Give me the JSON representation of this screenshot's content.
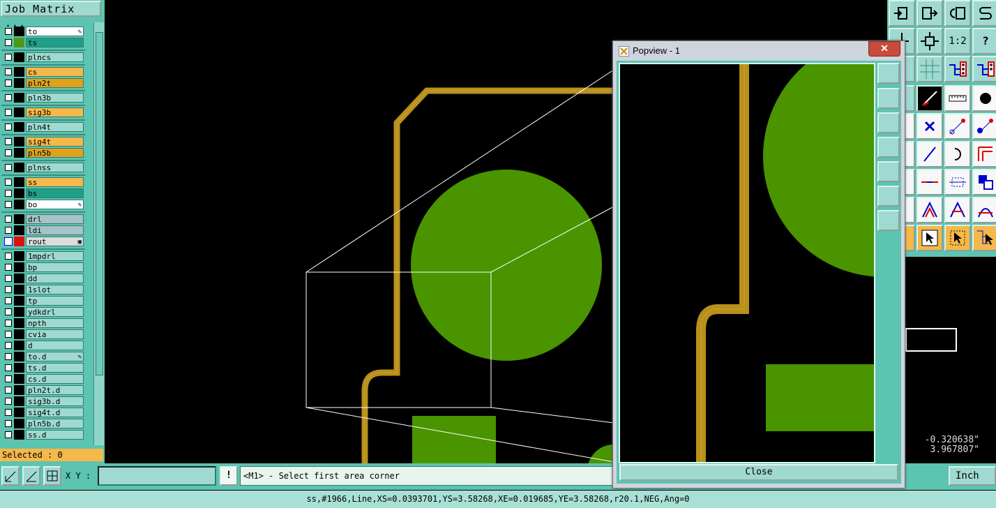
{
  "job_matrix": {
    "title": "Job Matrix ...",
    "selected_text": "Selected : 0",
    "layers": [
      {
        "name": "to",
        "color": "#ffffff",
        "swatch": "#000000",
        "mark": "✎"
      },
      {
        "name": "ts",
        "color": "#1f9f88",
        "swatch": "#4a9a1a",
        "mark": ""
      },
      {
        "name": "plncs",
        "color": "#9fd9cf",
        "swatch": "#000000",
        "mark": ""
      },
      {
        "name": "cs",
        "color": "#f5b84a",
        "swatch": "#000000",
        "mark": ""
      },
      {
        "name": "pln2t",
        "color": "#e0a21c",
        "swatch": "#000000",
        "mark": ""
      },
      {
        "name": "pln3b",
        "color": "#9fd9cf",
        "swatch": "#000000",
        "mark": ""
      },
      {
        "name": "sig3b",
        "color": "#f5b84a",
        "swatch": "#000000",
        "mark": ""
      },
      {
        "name": "pln4t",
        "color": "#9fd9cf",
        "swatch": "#000000",
        "mark": ""
      },
      {
        "name": "sig4t",
        "color": "#f5b84a",
        "swatch": "#000000",
        "mark": ""
      },
      {
        "name": "pln5b",
        "color": "#e0a21c",
        "swatch": "#000000",
        "mark": ""
      },
      {
        "name": "plnss",
        "color": "#9fd9cf",
        "swatch": "#000000",
        "mark": ""
      },
      {
        "name": "ss",
        "color": "#f5b84a",
        "swatch": "#000000",
        "mark": ""
      },
      {
        "name": "bs",
        "color": "#1f9f88",
        "swatch": "#000000",
        "mark": ""
      },
      {
        "name": "bo",
        "color": "#ffffff",
        "swatch": "#000000",
        "mark": "✎"
      },
      {
        "name": "drl",
        "color": "#a8c2c8",
        "swatch": "#000000",
        "mark": ""
      },
      {
        "name": "ldi",
        "color": "#a8c2c8",
        "swatch": "#000000",
        "mark": ""
      },
      {
        "name": "rout",
        "color": "#dcdcdc",
        "swatch": "#e01010",
        "mark": "▣"
      },
      {
        "name": "1mpdrl",
        "color": "#9fd9cf",
        "swatch": "#000000",
        "mark": ""
      },
      {
        "name": "bp",
        "color": "#9fd9cf",
        "swatch": "#000000",
        "mark": ""
      },
      {
        "name": "dd",
        "color": "#9fd9cf",
        "swatch": "#000000",
        "mark": ""
      },
      {
        "name": "1slot",
        "color": "#9fd9cf",
        "swatch": "#000000",
        "mark": ""
      },
      {
        "name": "tp",
        "color": "#9fd9cf",
        "swatch": "#000000",
        "mark": ""
      },
      {
        "name": "ydkdrl",
        "color": "#9fd9cf",
        "swatch": "#000000",
        "mark": ""
      },
      {
        "name": "npth",
        "color": "#9fd9cf",
        "swatch": "#000000",
        "mark": ""
      },
      {
        "name": "cvia",
        "color": "#9fd9cf",
        "swatch": "#000000",
        "mark": ""
      },
      {
        "name": "d",
        "color": "#9fd9cf",
        "swatch": "#000000",
        "mark": ""
      },
      {
        "name": "to.d",
        "color": "#9fd9cf",
        "swatch": "#000000",
        "mark": "✎"
      },
      {
        "name": "ts.d",
        "color": "#9fd9cf",
        "swatch": "#000000",
        "mark": ""
      },
      {
        "name": "cs.d",
        "color": "#9fd9cf",
        "swatch": "#000000",
        "mark": ""
      },
      {
        "name": "pln2t.d",
        "color": "#9fd9cf",
        "swatch": "#000000",
        "mark": ""
      },
      {
        "name": "sig3b.d",
        "color": "#9fd9cf",
        "swatch": "#000000",
        "mark": ""
      },
      {
        "name": "sig4t.d",
        "color": "#9fd9cf",
        "swatch": "#000000",
        "mark": ""
      },
      {
        "name": "pln5b.d",
        "color": "#9fd9cf",
        "swatch": "#000000",
        "mark": ""
      },
      {
        "name": "ss.d",
        "color": "#9fd9cf",
        "swatch": "#000000",
        "mark": ""
      }
    ]
  },
  "command_bar": {
    "xy_label": "X Y :",
    "xy_value": "",
    "info_icon": "!",
    "prompt": "<M1> - Select first area corner",
    "unit": "Inch"
  },
  "status_line": "ss,#1966,Line,XS=0.0393701,YS=3.58268,XE=0.019685,YE=3.58268,r20.1,NEG,Ang=0",
  "coordinates": {
    "x": "-0.320638\"",
    "y": "3.967807\""
  },
  "popview": {
    "title": "Popview - 1",
    "close_x": "✕",
    "close_label": "Close"
  },
  "toolbar": {
    "ratio_label": "1:2",
    "help_label": "?"
  },
  "colors": {
    "panel": "#5cc4b0",
    "trace": "#b8901a",
    "pad": "#4a9400",
    "background": "#000000"
  }
}
